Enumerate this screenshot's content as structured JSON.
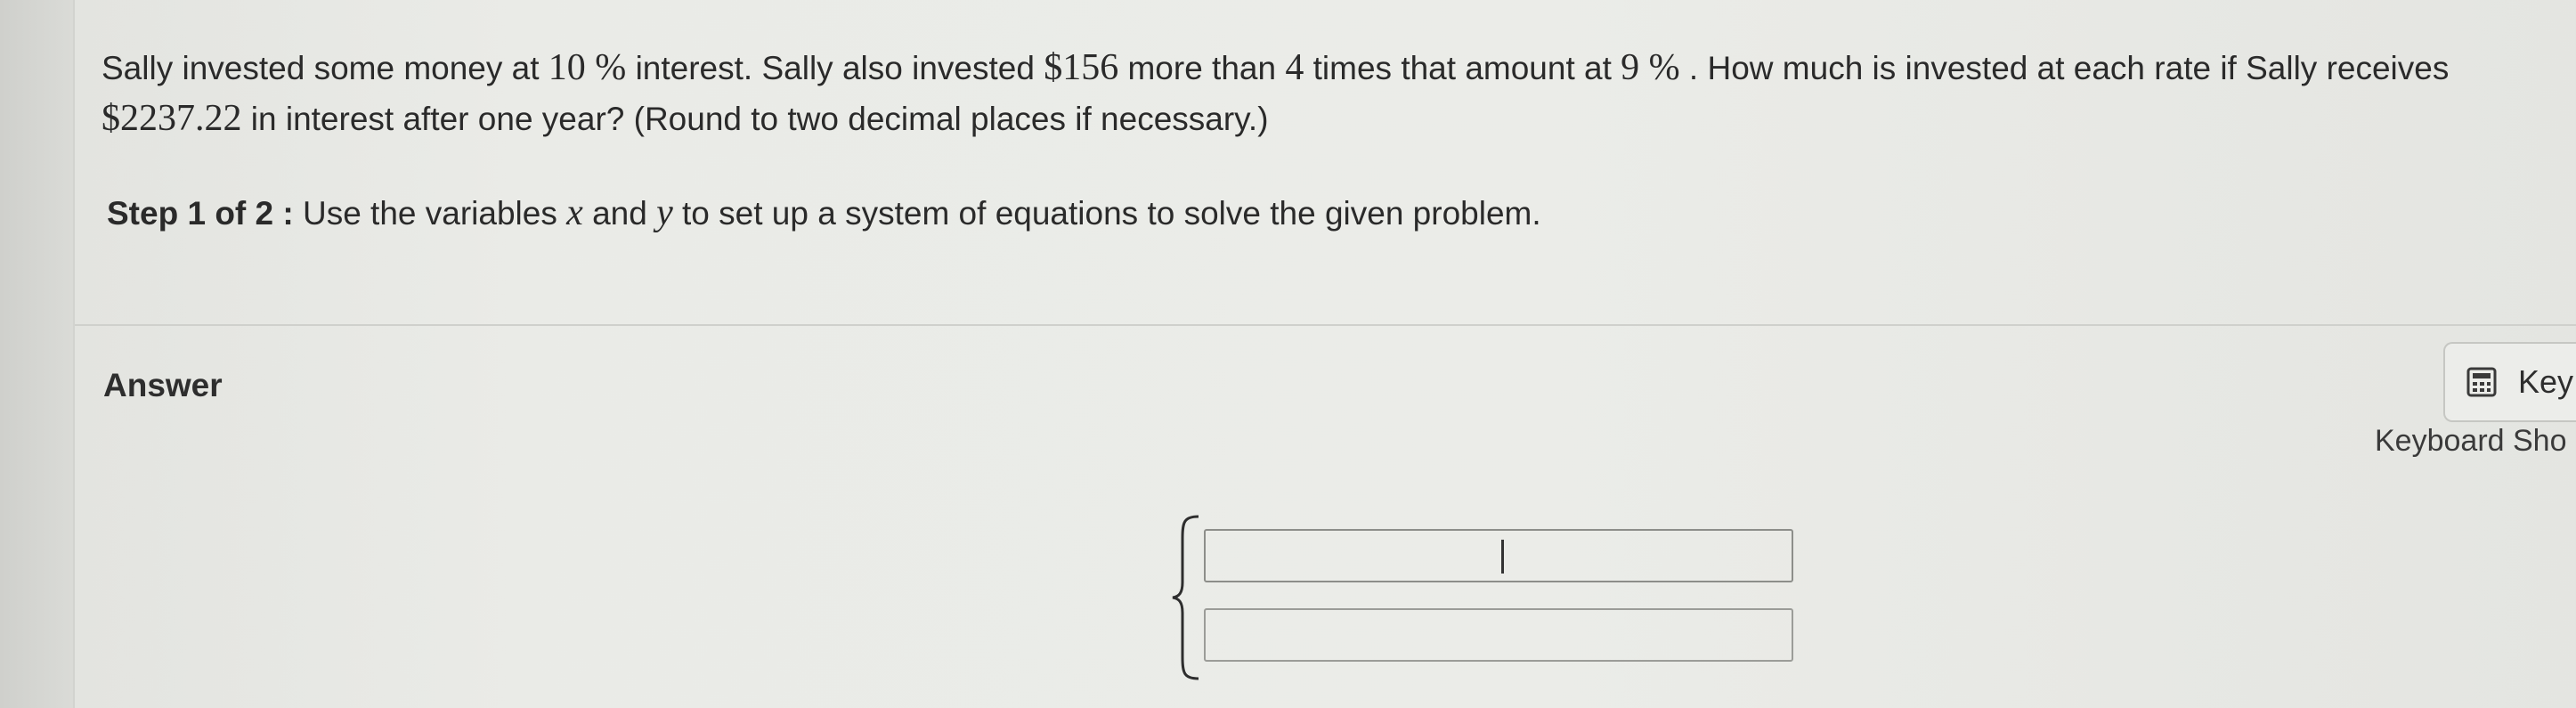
{
  "question": {
    "p1": "Sally invested some money at ",
    "rate1": "10 %",
    "p2": " interest. Sally also invested ",
    "extra": "$156",
    "p3": " more than ",
    "times": "4",
    "p4": " times that amount at ",
    "rate2": "9 %",
    "p5": " . How much is invested at each rate if Sally receives ",
    "total": "$2237.22",
    "p6": " in interest after one year? (Round to two decimal places if necessary.)"
  },
  "step": {
    "label": "Step 1 of 2 :",
    "t1": "Use the variables ",
    "var_x": "x",
    "t2": " and ",
    "var_y": "y",
    "t3": " to set up a system of equations to solve the given problem."
  },
  "answer": {
    "label": "Answer",
    "input1_value": "",
    "input2_value": ""
  },
  "toolbar": {
    "keypad_label": "Key",
    "shortcuts_label": "Keyboard Sho"
  }
}
